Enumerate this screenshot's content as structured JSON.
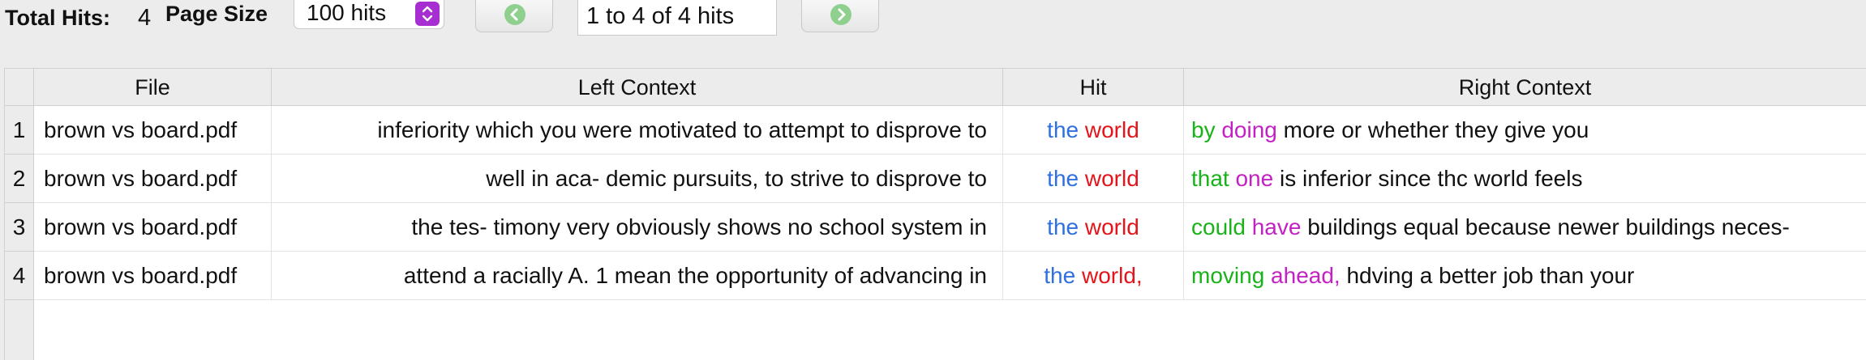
{
  "toolbar": {
    "total_hits_label": "Total Hits:",
    "total_hits_value": "4",
    "page_size_label": "Page Size",
    "page_size_value": "100 hits",
    "prev_icon": "arrow-left-circle-icon",
    "next_icon": "arrow-right-circle-icon",
    "range_text": "1 to 4 of 4 hits"
  },
  "table": {
    "columns": [
      "File",
      "Left Context",
      "Hit",
      "Right Context"
    ],
    "rows": [
      {
        "num": "1",
        "file": "brown vs board.pdf",
        "left": "inferiority which you were motivated to attempt to disprove to",
        "hit1": "the",
        "hit2": "world",
        "r1": "by",
        "r2": "doing",
        "r3": "more or whether they give you"
      },
      {
        "num": "2",
        "file": "brown vs board.pdf",
        "left": "well in aca- demic pursuits, to strive to disprove to",
        "hit1": "the",
        "hit2": "world",
        "r1": "that",
        "r2": "one",
        "r3": "is inferior since thc world feels"
      },
      {
        "num": "3",
        "file": "brown vs board.pdf",
        "left": "the tes- timony very obviously shows no school system in",
        "hit1": "the",
        "hit2": "world",
        "r1": "could",
        "r2": "have",
        "r3": "buildings equal because newer buildings neces-"
      },
      {
        "num": "4",
        "file": "brown vs board.pdf",
        "left": "attend a racially A. 1 mean the opportunity of advancing in",
        "hit1": "the",
        "hit2": "world,",
        "r1": "moving",
        "r2": "ahead,",
        "r3": "hdving a better job than your"
      }
    ]
  },
  "colors": {
    "hit_first": "#2f6fe0",
    "hit_second": "#e3141a",
    "right_first": "#19b319",
    "right_second": "#c321c3",
    "select_accent": "#a72fd1",
    "nav_icon": "#8fd08f"
  }
}
